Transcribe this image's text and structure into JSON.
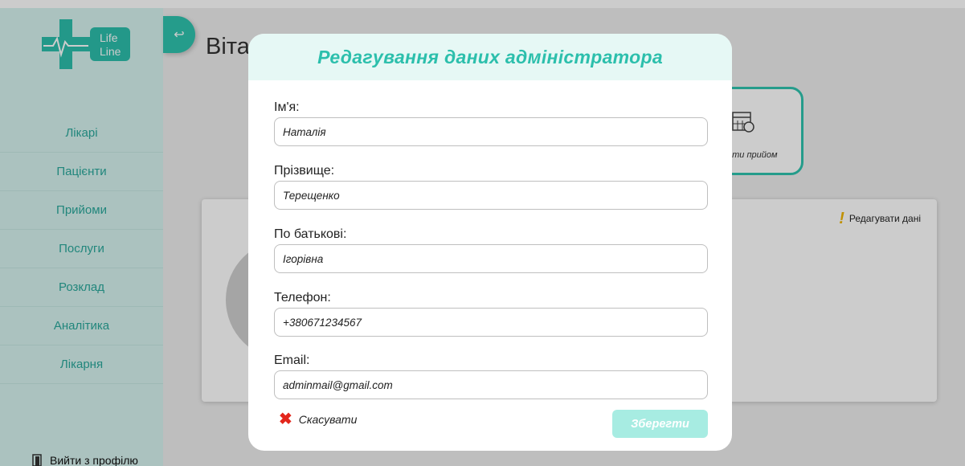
{
  "sidebar": {
    "logo_text_1": "Life",
    "logo_text_2": "Line",
    "items": [
      {
        "label": "Лікарі"
      },
      {
        "label": "Пацієнти"
      },
      {
        "label": "Прийоми"
      },
      {
        "label": "Послуги"
      },
      {
        "label": "Розклад"
      },
      {
        "label": "Аналітика"
      },
      {
        "label": "Лікарня"
      }
    ],
    "logout_label": "Вийти з профілю",
    "logout_icon": "door-icon"
  },
  "main": {
    "greeting": "Вітає",
    "quick_action": {
      "label": "ити прийом",
      "icon": "calendar-icon"
    },
    "profile_card": {
      "edit_label": "Редагувати дані"
    }
  },
  "modal": {
    "title": "Редагування даних адміністратора",
    "fields": [
      {
        "label": "Ім'я:",
        "value": "Наталія"
      },
      {
        "label": "Прізвище:",
        "value": "Терещенко"
      },
      {
        "label": "По батькові:",
        "value": "Ігорівна"
      },
      {
        "label": "Телефон:",
        "value": "+380671234567"
      },
      {
        "label": "Email:",
        "value": "adminmail@gmail.com"
      }
    ],
    "cancel_label": "Скасувати",
    "save_label": "Зберегти"
  },
  "colors": {
    "accent": "#2cbfac",
    "sidebar_bg": "#d6f3ef",
    "save_disabled": "#a7ece2",
    "cancel_red": "#e3261c"
  }
}
